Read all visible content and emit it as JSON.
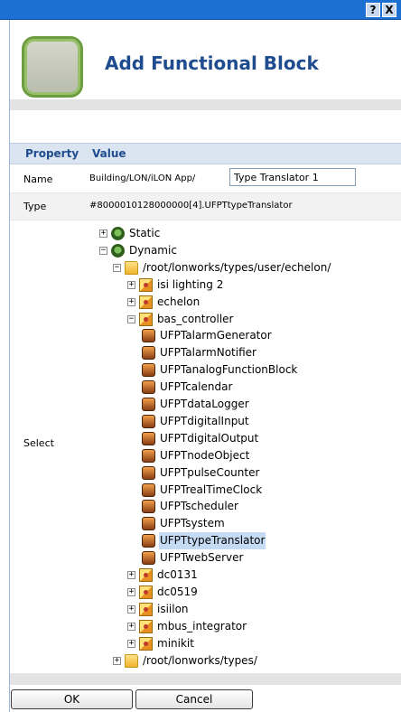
{
  "titlebar": {
    "help_label": "?",
    "close_label": "X"
  },
  "dialog": {
    "title": "Add Functional Block"
  },
  "table": {
    "header_property": "Property",
    "header_value": "Value",
    "rows": {
      "name": {
        "label": "Name",
        "path": "Building/LON/iLON App/",
        "input_value": "Type Translator 1"
      },
      "type": {
        "label": "Type",
        "value": "#8000010128000000[4].UFPTtypeTranslator"
      },
      "select": {
        "label": "Select"
      }
    }
  },
  "tree": [
    {
      "label": "Static",
      "icon": "gear-green-icon",
      "expander": "+",
      "level": 0
    },
    {
      "label": "Dynamic",
      "icon": "gear-green-icon",
      "expander": "-",
      "level": 0
    },
    {
      "label": "/root/lonworks/types/user/echelon/",
      "icon": "folder-icon",
      "expander": "-",
      "level": 1
    },
    {
      "label": "isi lighting 2",
      "icon": "package-icon",
      "expander": "+",
      "level": 2
    },
    {
      "label": "echelon",
      "icon": "package-icon",
      "expander": "+",
      "level": 2
    },
    {
      "label": "bas_controller",
      "icon": "package-icon",
      "expander": "-",
      "level": 2
    },
    {
      "label": "UFPTalarmGenerator",
      "icon": "block-icon",
      "level": 3
    },
    {
      "label": "UFPTalarmNotifier",
      "icon": "block-icon",
      "level": 3
    },
    {
      "label": "UFPTanalogFunctionBlock",
      "icon": "block-icon",
      "level": 3
    },
    {
      "label": "UFPTcalendar",
      "icon": "block-icon",
      "level": 3
    },
    {
      "label": "UFPTdataLogger",
      "icon": "block-icon",
      "level": 3
    },
    {
      "label": "UFPTdigitalInput",
      "icon": "block-icon",
      "level": 3
    },
    {
      "label": "UFPTdigitalOutput",
      "icon": "block-icon",
      "level": 3
    },
    {
      "label": "UFPTnodeObject",
      "icon": "block-icon",
      "level": 3
    },
    {
      "label": "UFPTpulseCounter",
      "icon": "block-icon",
      "level": 3
    },
    {
      "label": "UFPTrealTimeClock",
      "icon": "block-icon",
      "level": 3
    },
    {
      "label": "UFPTscheduler",
      "icon": "block-icon",
      "level": 3
    },
    {
      "label": "UFPTsystem",
      "icon": "block-icon",
      "level": 3
    },
    {
      "label": "UFPTtypeTranslator",
      "icon": "block-icon",
      "level": 3,
      "selected": true
    },
    {
      "label": "UFPTwebServer",
      "icon": "block-icon",
      "level": 3
    },
    {
      "label": "dc0131",
      "icon": "package-icon",
      "expander": "+",
      "level": 2
    },
    {
      "label": "dc0519",
      "icon": "package-icon",
      "expander": "+",
      "level": 2
    },
    {
      "label": "isiilon",
      "icon": "package-icon",
      "expander": "+",
      "level": 2
    },
    {
      "label": "mbus_integrator",
      "icon": "package-icon",
      "expander": "+",
      "level": 2
    },
    {
      "label": "minikit",
      "icon": "package-icon",
      "expander": "+",
      "level": 2
    },
    {
      "label": "/root/lonworks/types/",
      "icon": "folder-icon",
      "expander": "+",
      "level": 1
    }
  ],
  "buttons": {
    "ok": "OK",
    "cancel": "Cancel"
  },
  "colors": {
    "titlebar": "#1c6fd3",
    "heading": "#1e4c8e",
    "selection": "#c5daf3"
  }
}
